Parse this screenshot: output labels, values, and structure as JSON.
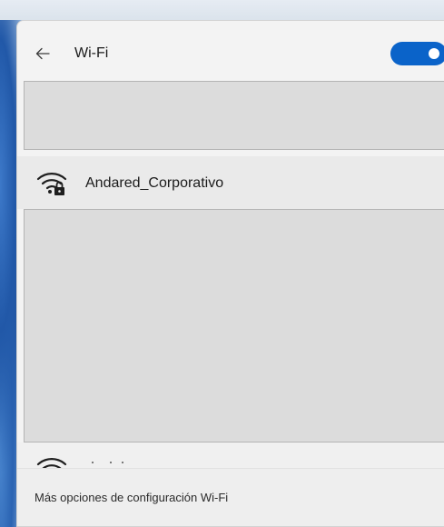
{
  "header": {
    "back_icon": "arrow-left-icon",
    "title": "Wi-Fi",
    "wifi_toggle": {
      "state": "on",
      "accent_color": "#0a63c9"
    }
  },
  "networks": [
    {
      "name": "Andared_Corporativo",
      "icon": "wifi-secured-icon",
      "secured": true
    }
  ],
  "partially_visible_network": {
    "icon": "wifi-icon"
  },
  "footer": {
    "more_settings_label": "Más opciones de configuración Wi-Fi"
  }
}
